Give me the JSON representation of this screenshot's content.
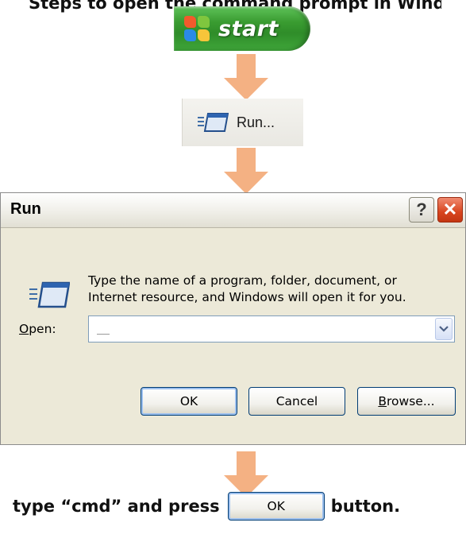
{
  "top_caption": "Steps to open the command prompt in Windows XP",
  "start_button": {
    "label": "start",
    "icon": "windows-flag-icon"
  },
  "arrow": {
    "color": "#f4b183",
    "icon": "down-arrow-icon"
  },
  "run_menu_item": {
    "label": "Run...",
    "icon": "run-icon"
  },
  "run_dialog": {
    "title": "Run",
    "help_label": "?",
    "close_label": "✕",
    "description_line1": "Type the name of a program, folder, document, or",
    "description_line2": "Internet resource, and Windows will open it for you.",
    "open_label_prefix": "O",
    "open_label_rest": "pen:",
    "open_value": "",
    "ok_label": "OK",
    "cancel_label": "Cancel",
    "browse_label_prefix": "B",
    "browse_label_rest": "rowse..."
  },
  "instruction": {
    "before": "type “cmd” and press",
    "button_label": "OK",
    "after": "button."
  },
  "colors": {
    "start_green": "#3a9c31",
    "dialog_bg": "#ece9d8",
    "close_red": "#d8451f",
    "button_border": "#003c74"
  }
}
